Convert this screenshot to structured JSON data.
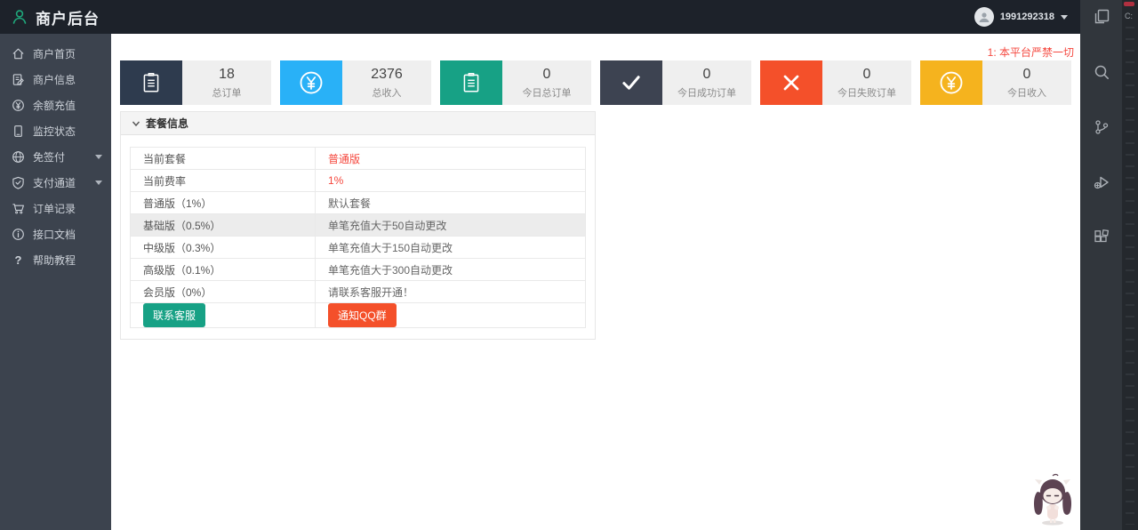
{
  "header": {
    "title": "商户后台",
    "user": {
      "id": "1991292318"
    }
  },
  "announcement": {
    "text": "1: 本平台严禁一切"
  },
  "sidebar": {
    "items": [
      {
        "label": "商户首页",
        "icon": "home-icon",
        "has_submenu": false
      },
      {
        "label": "商户信息",
        "icon": "edit-document-icon",
        "has_submenu": false
      },
      {
        "label": "余额充值",
        "icon": "yen-circle-icon",
        "has_submenu": false
      },
      {
        "label": "监控状态",
        "icon": "monitor-icon",
        "has_submenu": false
      },
      {
        "label": "免签付",
        "icon": "globe-icon",
        "has_submenu": true
      },
      {
        "label": "支付通道",
        "icon": "shield-check-icon",
        "has_submenu": true
      },
      {
        "label": "订单记录",
        "icon": "cart-icon",
        "has_submenu": false
      },
      {
        "label": "接口文档",
        "icon": "info-circle-icon",
        "has_submenu": false
      },
      {
        "label": "帮助教程",
        "icon": "question-icon",
        "has_submenu": false
      }
    ]
  },
  "stats": [
    {
      "value": "18",
      "label": "总订单",
      "icon": "clipboard-icon",
      "color": "#2e3b4e"
    },
    {
      "value": "2376",
      "label": "总收入",
      "icon": "yen-circle-icon",
      "color": "#29b1f7"
    },
    {
      "value": "0",
      "label": "今日总订单",
      "icon": "clipboard-icon",
      "color": "#17a185"
    },
    {
      "value": "0",
      "label": "今日成功订单",
      "icon": "check-icon",
      "color": "#3d4351"
    },
    {
      "value": "0",
      "label": "今日失败订单",
      "icon": "x-icon",
      "color": "#f4502a"
    },
    {
      "value": "0",
      "label": "今日收入",
      "icon": "yen-circle-icon",
      "color": "#f5b31e"
    }
  ],
  "panel": {
    "title": "套餐信息",
    "rows": [
      {
        "label": "当前套餐",
        "value": "普通版",
        "value_red": true,
        "highlight": false
      },
      {
        "label": "当前费率",
        "value": "1%",
        "value_red": true,
        "highlight": false
      },
      {
        "label": "普通版（1%）",
        "value": "默认套餐",
        "value_red": false,
        "highlight": false
      },
      {
        "label": "基础版（0.5%）",
        "value": "单笔充值大于50自动更改",
        "value_red": false,
        "highlight": true
      },
      {
        "label": "中级版（0.3%）",
        "value": "单笔充值大于150自动更改",
        "value_red": false,
        "highlight": false
      },
      {
        "label": "高级版（0.1%）",
        "value": "单笔充值大于300自动更改",
        "value_red": false,
        "highlight": false
      },
      {
        "label": "会员版（0%）",
        "value": "请联系客服开通！",
        "value_red": false,
        "highlight": false
      }
    ],
    "buttons": [
      {
        "label": "联系客服",
        "color": "#17a185"
      },
      {
        "label": "通知QQ群",
        "color": "#f4502a"
      }
    ]
  },
  "right_toolbar": {
    "icons": [
      "pages-icon",
      "search-icon",
      "source-control-icon",
      "run-debug-icon",
      "extensions-icon"
    ]
  },
  "editor_sliver": {
    "label": "C:"
  }
}
